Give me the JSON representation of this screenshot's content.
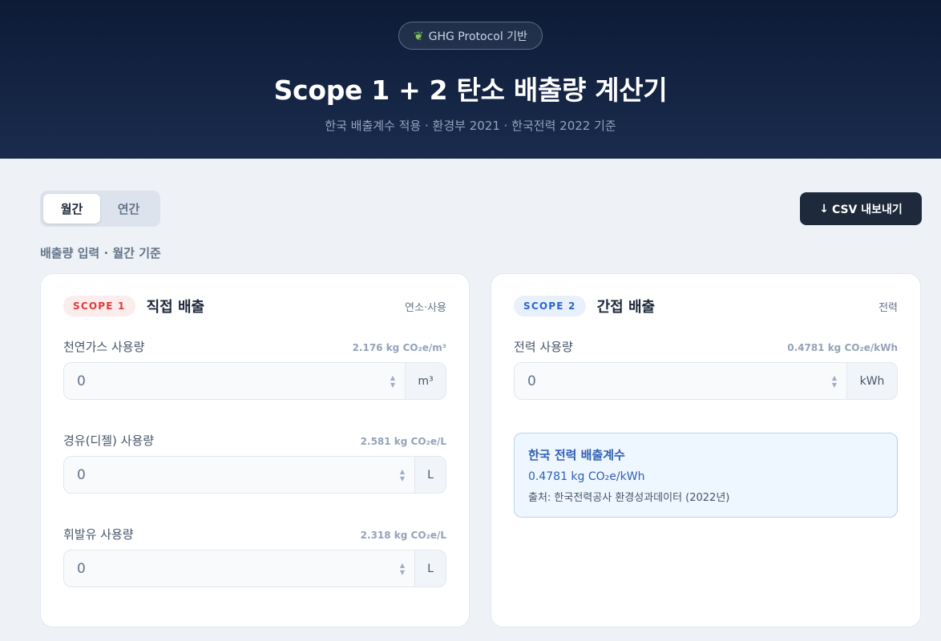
{
  "header": {
    "badge_icon": "leaf-icon",
    "badge": "GHG Protocol 기반",
    "title": "Scope 1 + 2 탄소 배출량 계산기",
    "subtitle": "한국 배출계수 적용 · 환경부 2021 · 한국전력 2022 기준"
  },
  "period_toggle": {
    "monthly": "월간",
    "yearly": "연간",
    "selected": "월간"
  },
  "export": {
    "label": "CSV 내보내기",
    "icon": "↓"
  },
  "section_label": "배출량 입력 · 월간 기준",
  "scope1": {
    "badge": "SCOPE 1",
    "title": "직접 배출",
    "tag": "연소·사용",
    "fields": [
      {
        "label": "천연가스 사용량",
        "factor": "2.176 kg CO₂e/m³",
        "value": "0",
        "unit": "m³"
      },
      {
        "label": "경유(디젤) 사용량",
        "factor": "2.581 kg CO₂e/L",
        "value": "0",
        "unit": "L"
      },
      {
        "label": "휘발유 사용량",
        "factor": "2.318 kg CO₂e/L",
        "value": "0",
        "unit": "L"
      }
    ]
  },
  "scope2": {
    "badge": "SCOPE 2",
    "title": "간접 배출",
    "tag": "전력",
    "fields": [
      {
        "label": "전력 사용량",
        "factor": "0.4781 kg CO₂e/kWh",
        "value": "0",
        "unit": "kWh"
      }
    ],
    "info": {
      "title": "한국 전력 배출계수",
      "value": "0.4781 kg CO₂e/kWh",
      "source": "출처: 한국전력공사 환경성과데이터 (2022년)"
    }
  },
  "colors": {
    "header_bg": "#0d1b36",
    "scope1_accent": "#dc3b3b",
    "scope2_accent": "#2f66c9",
    "button_dark": "#1e293b"
  }
}
